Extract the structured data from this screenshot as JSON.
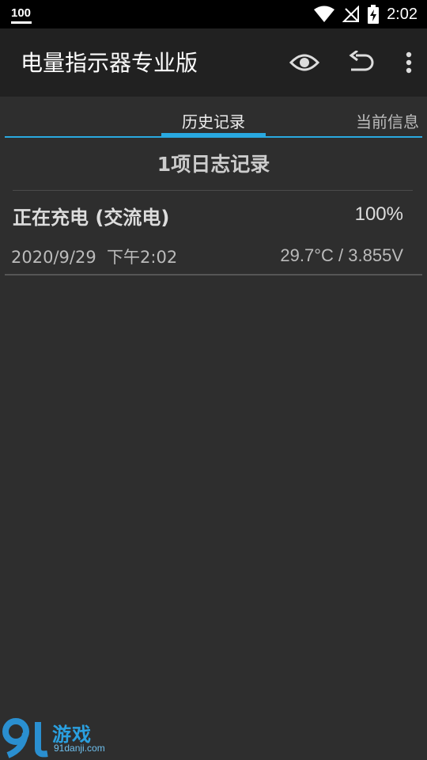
{
  "status_bar": {
    "battery_level": "100",
    "time": "2:02"
  },
  "app_bar": {
    "title": "电量指示器专业版",
    "actions": [
      "eye-icon",
      "undo-icon",
      "overflow-menu-icon"
    ]
  },
  "tabs": {
    "active": "历史记录",
    "other": "当前信息"
  },
  "log": {
    "header": "1项日志记录",
    "entries": [
      {
        "status": "正在充电 (交流电)",
        "percent": "100%",
        "datetime": "2020/9/29  下午2:02",
        "stats": "29.7°C / 3.855V"
      }
    ]
  },
  "watermark": {
    "text": "游戏",
    "sub": "91danji.com"
  },
  "colors": {
    "accent": "#29a9e0",
    "app_bar": "#212121",
    "background": "#2e2e2e",
    "status_bar": "#000000"
  }
}
